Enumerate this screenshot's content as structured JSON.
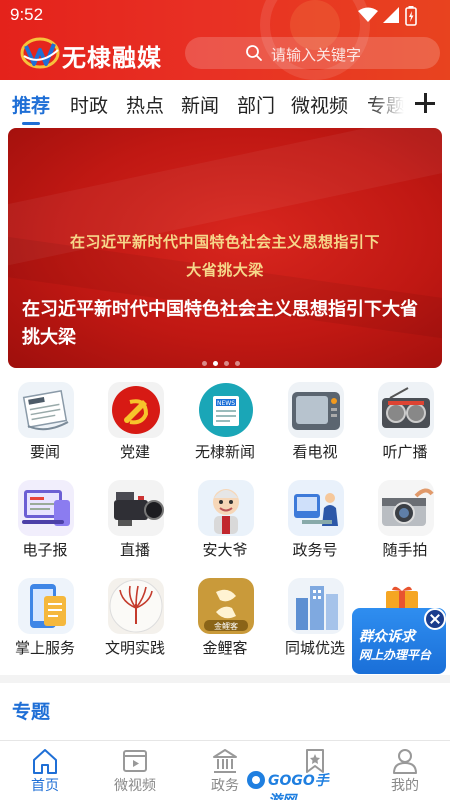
{
  "status_bar": {
    "time": "9:52"
  },
  "header": {
    "brand": "无棣融媒",
    "search_placeholder": "请输入关键字"
  },
  "tabs": [
    {
      "label": "推荐",
      "active": true
    },
    {
      "label": "时政"
    },
    {
      "label": "热点"
    },
    {
      "label": "新闻"
    },
    {
      "label": "部门"
    },
    {
      "label": "微视频"
    },
    {
      "label": "专题"
    }
  ],
  "banner": {
    "poster_line1": "在习近平新时代中国特色社会主义思想指引下",
    "poster_line2": "大省挑大梁",
    "caption": "在习近平新时代中国特色社会主义思想指引下大省挑大梁",
    "slide_count": 4,
    "active_slide": 1
  },
  "grid": [
    {
      "label": "要闻",
      "icon": "newspaper-icon"
    },
    {
      "label": "党建",
      "icon": "party-emblem-icon"
    },
    {
      "label": "无棣新闻",
      "icon": "news-badge-icon"
    },
    {
      "label": "看电视",
      "icon": "tv-icon"
    },
    {
      "label": "听广播",
      "icon": "radio-icon"
    },
    {
      "label": "电子报",
      "icon": "e-paper-icon"
    },
    {
      "label": "直播",
      "icon": "video-camera-icon"
    },
    {
      "label": "安大爷",
      "icon": "grandpa-icon"
    },
    {
      "label": "政务号",
      "icon": "government-account-icon"
    },
    {
      "label": "随手拍",
      "icon": "camera-icon"
    },
    {
      "label": "掌上服务",
      "icon": "mobile-service-icon"
    },
    {
      "label": "文明实践",
      "icon": "civilization-practice-icon"
    },
    {
      "label": "金鲤客",
      "icon": "golden-carp-icon",
      "icon_text": "金鲤客"
    },
    {
      "label": "同城优选",
      "icon": "city-select-icon"
    }
  ],
  "float_ad": {
    "line1": "群众诉求",
    "line2": "网上办理平台"
  },
  "section": {
    "title": "专题"
  },
  "bottom_nav": [
    {
      "label": "首页",
      "icon": "home-icon",
      "active": true
    },
    {
      "label": "微视频",
      "icon": "video-icon"
    },
    {
      "label": "政务",
      "icon": "government-building-icon"
    },
    {
      "label": "",
      "icon": "bookmark-star-icon"
    },
    {
      "label": "我的",
      "icon": "user-icon"
    }
  ],
  "watermark": {
    "text": "GOGO手游网"
  },
  "colors": {
    "brand_red": "#e4221b",
    "accent_blue": "#1f6fd6",
    "banner_red": "#c01813"
  }
}
